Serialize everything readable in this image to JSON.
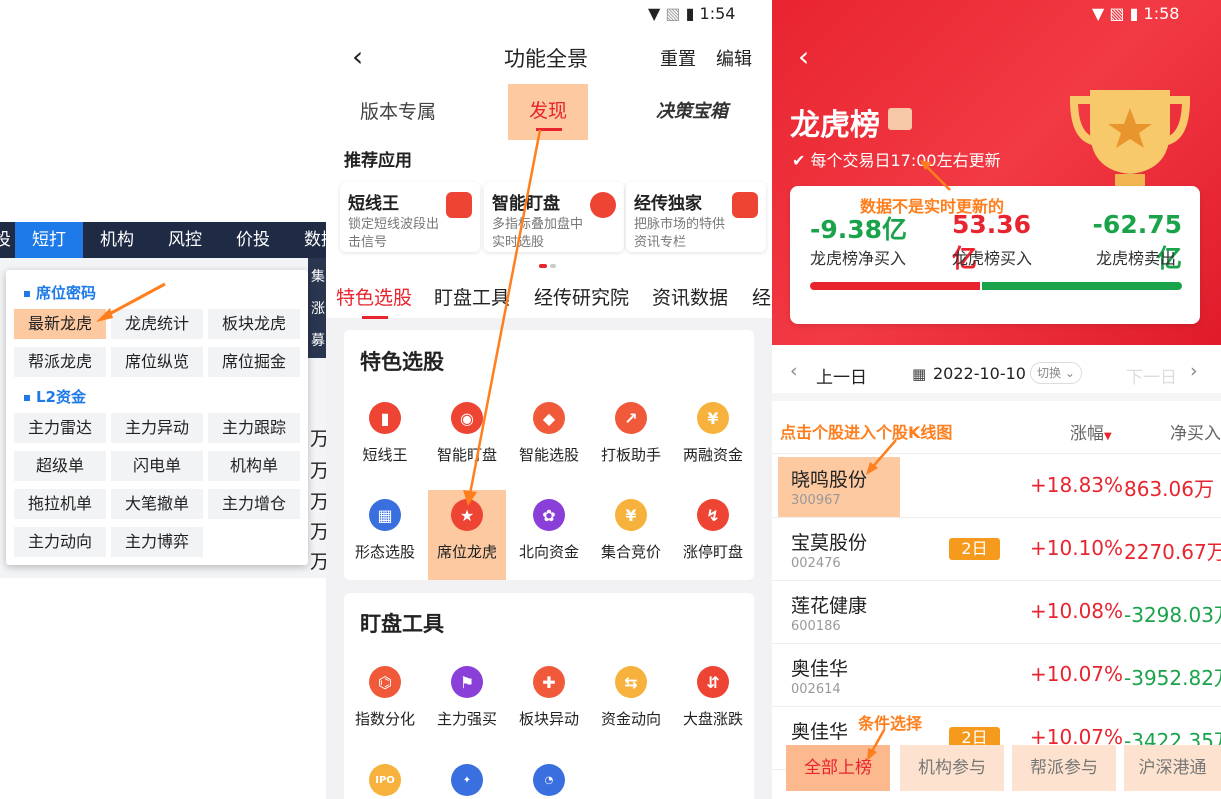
{
  "panel1": {
    "nav": [
      "投",
      "短打",
      "机构",
      "风控",
      "价投",
      "数据"
    ],
    "nav_active": 1,
    "bg_side": [
      "集",
      "涨",
      "募"
    ],
    "bg_right": [
      "万",
      "万",
      "万",
      "万",
      "万"
    ],
    "sections": [
      {
        "title": "席位密码",
        "items": [
          "最新龙虎",
          "龙虎统计",
          "板块龙虎",
          "帮派龙虎",
          "席位纵览",
          "席位掘金"
        ]
      },
      {
        "title": "L2资金",
        "items": [
          "主力雷达",
          "主力异动",
          "主力跟踪",
          "超级单",
          "闪电单",
          "机构单",
          "拖拉机单",
          "大笔撤单",
          "主力增仓",
          "主力动向",
          "主力博弈"
        ]
      }
    ],
    "highlight": "最新龙虎"
  },
  "panel2": {
    "status_time": "1:54",
    "title": "功能全景",
    "reset": "重置",
    "edit": "编辑",
    "top_tabs": [
      "版本专属",
      "发现",
      "决策宝箱"
    ],
    "rec_title": "推荐应用",
    "rec_apps": [
      {
        "title": "短线王",
        "desc": "锁定短线波段出击信号"
      },
      {
        "title": "智能盯盘",
        "desc": "多指标叠加盘中实时选股"
      },
      {
        "title": "经传独家",
        "desc": "把脉市场的特供资讯专栏"
      }
    ],
    "cat_tabs": [
      "特色选股",
      "盯盘工具",
      "经传研究院",
      "资讯数据",
      "经"
    ],
    "sec1_title": "特色选股",
    "sec1_items": [
      "短线王",
      "智能盯盘",
      "智能选股",
      "打板助手",
      "两融资金",
      "形态选股",
      "席位龙虎",
      "北向资金",
      "集合竞价",
      "涨停盯盘"
    ],
    "sec2_title": "盯盘工具",
    "sec2_items": [
      "指数分化",
      "主力强买",
      "板块异动",
      "资金动向",
      "大盘涨跌"
    ],
    "icon_glyphs": [
      "▮",
      "◉",
      "◆",
      "↗",
      "¥",
      "▦",
      "★",
      "✿",
      "¥",
      "↯"
    ],
    "icon_glyphs2": [
      "⌬",
      "⚑",
      "✚",
      "⇆",
      "⇵"
    ],
    "last_row_glyphs": [
      "IPO",
      "✦",
      "◔"
    ]
  },
  "panel3": {
    "status_time": "1:58",
    "title": "龙虎榜",
    "update_note": "每个交易日17:00左右更新",
    "summary": [
      {
        "value": "-9.38亿",
        "label": "龙虎榜净买入",
        "color": "#1aa34a"
      },
      {
        "value": "53.36亿",
        "label": "龙虎榜买入",
        "color": "#e8242f"
      },
      {
        "value": "-62.75亿",
        "label": "龙虎榜卖出",
        "color": "#1aa34a"
      }
    ],
    "prev_day": "上一日",
    "date": "2022-10-10",
    "switch": "切换",
    "next_day": "下一日",
    "col_headers": [
      "涨幅",
      "净买入"
    ],
    "rows": [
      {
        "name": "晓鸣股份",
        "code": "300967",
        "pct": "+18.83%",
        "amt": "863.06万",
        "amt_color": "#e8242f",
        "badge": ""
      },
      {
        "name": "宝莫股份",
        "code": "002476",
        "pct": "+10.10%",
        "amt": "2270.67万",
        "amt_color": "#e8242f",
        "badge": "2日"
      },
      {
        "name": "莲花健康",
        "code": "600186",
        "pct": "+10.08%",
        "amt": "-3298.03万",
        "amt_color": "#1aa34a",
        "badge": ""
      },
      {
        "name": "奥佳华",
        "code": "002614",
        "pct": "+10.07%",
        "amt": "-3952.82万",
        "amt_color": "#1aa34a",
        "badge": ""
      },
      {
        "name": "奥佳华",
        "code": "",
        "pct": "+10.07%",
        "amt": "-3422.35万",
        "amt_color": "#1aa34a",
        "badge": "2日"
      }
    ],
    "bottom_tabs": [
      "全部上榜",
      "机构参与",
      "帮派参与",
      "沪深港通"
    ],
    "annotations": {
      "not_realtime": "数据不是实时更新的",
      "click_stock": "点击个股进入个股K线图",
      "condition": "条件选择"
    }
  },
  "colors": {
    "brand_red": "#e8242f",
    "blue": "#1e7ae8",
    "green": "#1aa34a",
    "orange": "#ff7f1e"
  }
}
